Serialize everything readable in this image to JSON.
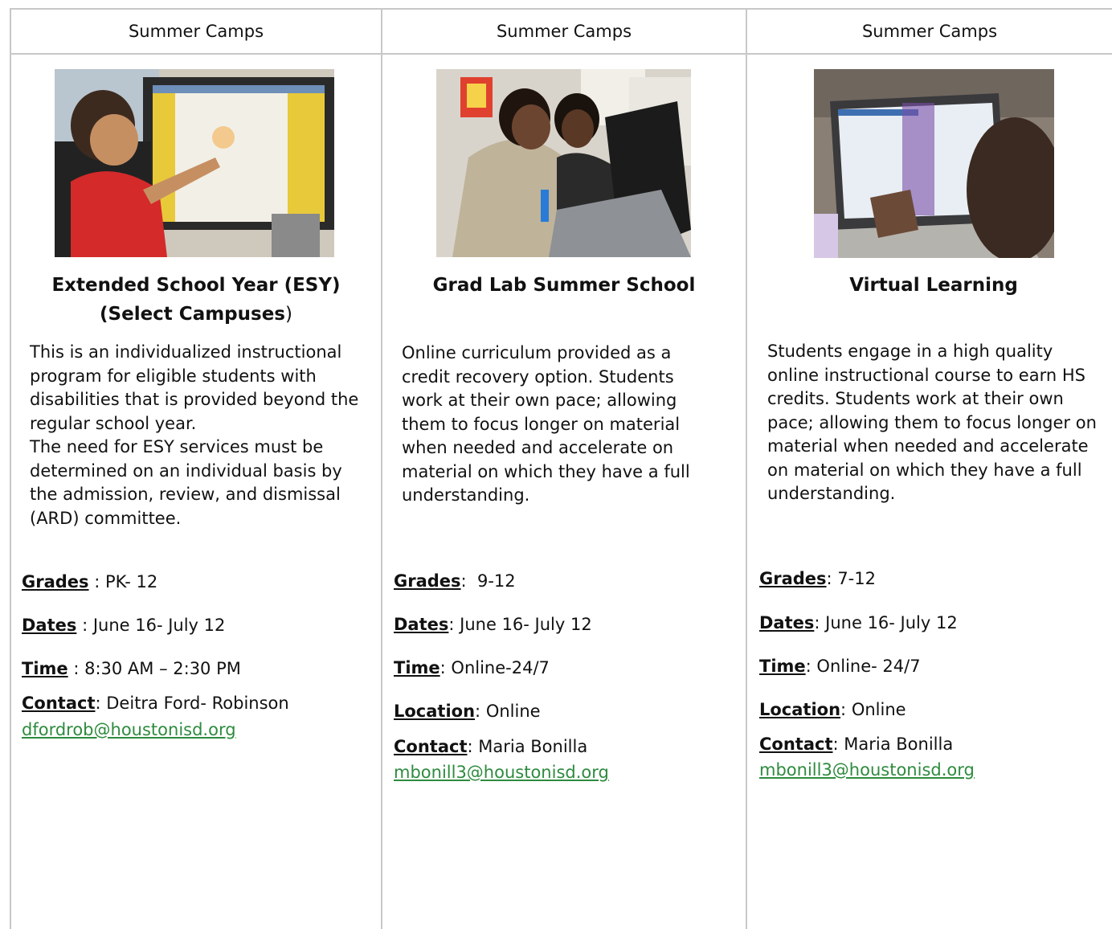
{
  "columns": [
    {
      "header": "Summer Camps",
      "title_line1": "Extended School Year (ESY)",
      "title_line2": "(Select Campuses",
      "title_paren": ")",
      "description_p1": "This is an individualized instructional program for eligible students with disabilities that is provided beyond the regular school year.",
      "description_p2": "The need for ESY services must be determined on an individual basis by the admission, review, and dismissal (ARD) committee.",
      "grades_label": "Grades",
      "grades_sep": " : ",
      "grades_value": "PK- 12",
      "dates_label": "Dates",
      "dates_sep": " : ",
      "dates_value": "June 16- July 12",
      "time_label": "Time",
      "time_sep": " : ",
      "time_value": "8:30 AM – 2:30 PM",
      "contact_label": "Contact",
      "contact_sep": ": ",
      "contact_value": "Deitra Ford- Robinson",
      "email": "dfordrob@houstonisd.org"
    },
    {
      "header": "Summer Camps",
      "title_line1": "Grad Lab Summer School",
      "description": "Online curriculum provided as a credit recovery option. Students work at their own pace; allowing them to focus longer on material when needed and accelerate on material on which they have a full understanding.",
      "grades_label": "Grades",
      "grades_sep": ":  ",
      "grades_value": "9-12",
      "dates_label": "Dates",
      "dates_sep": ": ",
      "dates_value": "June 16- July 12",
      "time_label": "Time",
      "time_sep": ": ",
      "time_value": "Online-24/7",
      "location_label": "Location",
      "location_sep": ": ",
      "location_value": "Online",
      "contact_label": "Contact",
      "contact_sep": ": ",
      "contact_value": "Maria Bonilla",
      "email": "mbonill3@houstonisd.org"
    },
    {
      "header": "Summer Camps",
      "title_line1": "Virtual Learning",
      "description": "Students engage in a high quality online instructional course to earn HS credits. Students work at their own pace; allowing them to focus longer on material when needed and accelerate on material on which they have a full understanding.",
      "grades_label": "Grades",
      "grades_sep": ": ",
      "grades_value": "7-12",
      "dates_label": "Dates",
      "dates_sep": ": ",
      "dates_value": "June 16- July 12",
      "time_label": "Time",
      "time_sep": ": ",
      "time_value": "Online- 24/7",
      "location_label": "Location",
      "location_sep": ": ",
      "location_value": "Online",
      "contact_label": "Contact",
      "contact_sep": ": ",
      "contact_value": "Maria Bonilla",
      "email": "mbonill3@houstonisd.org"
    }
  ],
  "colors": {
    "grid": "#c8c8c8",
    "link": "#2e8b3e"
  }
}
